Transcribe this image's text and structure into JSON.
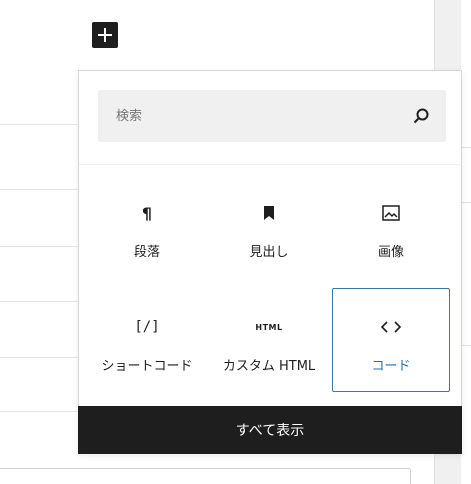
{
  "toolbar": {
    "add_block_icon": "plus-icon"
  },
  "inserter": {
    "search": {
      "placeholder": "検索",
      "value": "",
      "icon": "search-icon"
    },
    "blocks": [
      {
        "label": "段落",
        "icon": "paragraph-icon",
        "glyph": "¶"
      },
      {
        "label": "見出し",
        "icon": "bookmark-icon",
        "glyph": ""
      },
      {
        "label": "画像",
        "icon": "image-icon",
        "glyph": ""
      },
      {
        "label": "ショートコード",
        "icon": "shortcode-icon",
        "glyph": "[/]"
      },
      {
        "label": "カスタム HTML",
        "icon": "html-icon",
        "glyph": "HTML"
      },
      {
        "label": "コード",
        "icon": "code-icon",
        "glyph": "<>"
      }
    ],
    "active_block": "コード",
    "show_all_label": "すべて表示"
  },
  "colors": {
    "dark": "#1e1e1e",
    "accent": "#2271b1",
    "search_bg": "#f0f0f0"
  }
}
